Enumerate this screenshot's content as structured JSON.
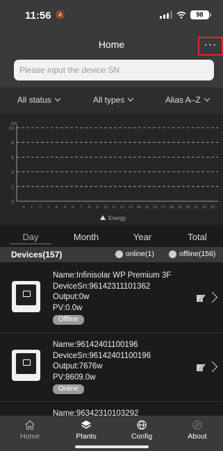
{
  "status_bar": {
    "time": "11:56",
    "battery": "98"
  },
  "header": {
    "title": "Home",
    "more_label": "···"
  },
  "search": {
    "placeholder": "Please input the device SN"
  },
  "filters": {
    "status": "All status",
    "type": "All types",
    "sort": "Alias A–Z"
  },
  "chart_data": {
    "type": "line",
    "title": "",
    "xlabel": "",
    "ylabel": "kW",
    "x": [
      0,
      1,
      2,
      3,
      4,
      5,
      6,
      7,
      8,
      9,
      10,
      11,
      12,
      13,
      14,
      15,
      16,
      17,
      18,
      19,
      20,
      21,
      22,
      23
    ],
    "ylim": [
      0,
      10
    ],
    "yticks": [
      0,
      2,
      4,
      6,
      8,
      10
    ],
    "grid": true,
    "series": [
      {
        "name": "Energy",
        "values": []
      }
    ],
    "legend": "bottom-center"
  },
  "period_tabs": [
    "Day",
    "Month",
    "Year",
    "Total"
  ],
  "devices": {
    "title": "Devices(157)",
    "online_label": "online(1)",
    "offline_label": "offline(156)",
    "items": [
      {
        "name": "Name:Infinisolar WP Premium 3F",
        "sn": "DeviceSn:96142311101362",
        "output": "Output:0w",
        "pv": "PV:0.0w",
        "status": "Offline"
      },
      {
        "name": "Name:96142401100196",
        "sn": "DeviceSn:96142401100196",
        "output": "Output:7676w",
        "pv": "PV:8609.0w",
        "status": "Online"
      },
      {
        "name": "Name:96342310103292"
      }
    ]
  },
  "tabbar": {
    "items": [
      {
        "label": "Home",
        "icon": "home-icon"
      },
      {
        "label": "Plants",
        "icon": "plants-icon"
      },
      {
        "label": "Config",
        "icon": "globe-icon"
      },
      {
        "label": "About",
        "icon": "compass-icon"
      }
    ]
  },
  "colors": {
    "accent": "#e0282a",
    "background": "#1b1b1b",
    "bar": "#3a3a3a"
  }
}
